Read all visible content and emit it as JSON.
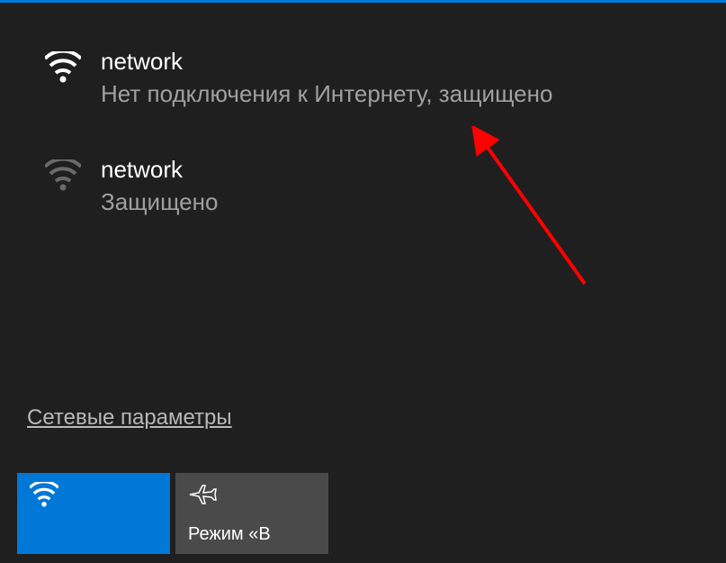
{
  "networks": [
    {
      "name": "network",
      "status": "Нет подключения к Интернету, защищено",
      "connected": true
    },
    {
      "name": "network",
      "status": "Защищено",
      "connected": false
    }
  ],
  "settings_link_label": "Сетевые параметры",
  "tiles": {
    "wifi": {
      "label": "",
      "active": true
    },
    "airplane": {
      "label": "Режим «В"
    }
  },
  "colors": {
    "accent": "#0078d7",
    "background": "#1f1f1f",
    "text_primary": "#ffffff",
    "text_secondary": "#a0a0a0",
    "tile_inactive": "#4a4a4a",
    "annotation": "#ff0000"
  }
}
